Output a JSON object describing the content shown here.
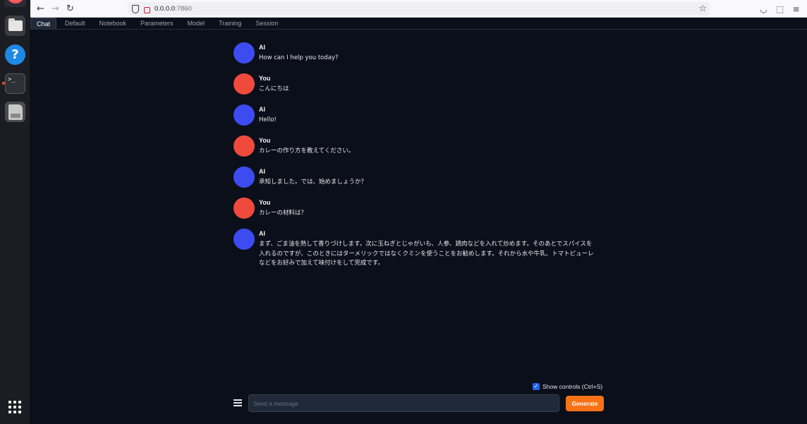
{
  "browser": {
    "url_host": "0.0.0.0",
    "url_port": ":7860"
  },
  "tabs": [
    "Chat",
    "Default",
    "Notebook",
    "Parameters",
    "Model",
    "Training",
    "Session"
  ],
  "active_tab": "Chat",
  "messages": [
    {
      "sender": "AI",
      "role": "ai",
      "text": "How can I help you today?"
    },
    {
      "sender": "You",
      "role": "user",
      "text": "こんにちは"
    },
    {
      "sender": "AI",
      "role": "ai",
      "text": "Hello!"
    },
    {
      "sender": "You",
      "role": "user",
      "text": "カレーの作り方を教えてください。"
    },
    {
      "sender": "AI",
      "role": "ai",
      "text": "承知しました。では、始めましょうか？"
    },
    {
      "sender": "You",
      "role": "user",
      "text": "カレーの材料は？"
    },
    {
      "sender": "AI",
      "role": "ai",
      "text": "まず、ごま油を熱して香りづけします。次に玉ねぎとじゃがいも、人参、鶏肉などを入れて炒めます。そのあとでスパイスを入れるのですが、このときにはターメリックではなくクミンを使うことをお勧めします。それから水や牛乳、トマトピューレなどをお好みで加えて味付けをして完成です。"
    }
  ],
  "controls": {
    "show_controls_label": "Show controls (Ctrl+S)",
    "show_controls_checked": true,
    "input_placeholder": "Send a message",
    "generate_label": "Generate"
  },
  "colors": {
    "ai_avatar": "#3d4cf0",
    "user_avatar": "#ef4a3c",
    "generate": "#f97316",
    "background": "#0b0f19"
  }
}
